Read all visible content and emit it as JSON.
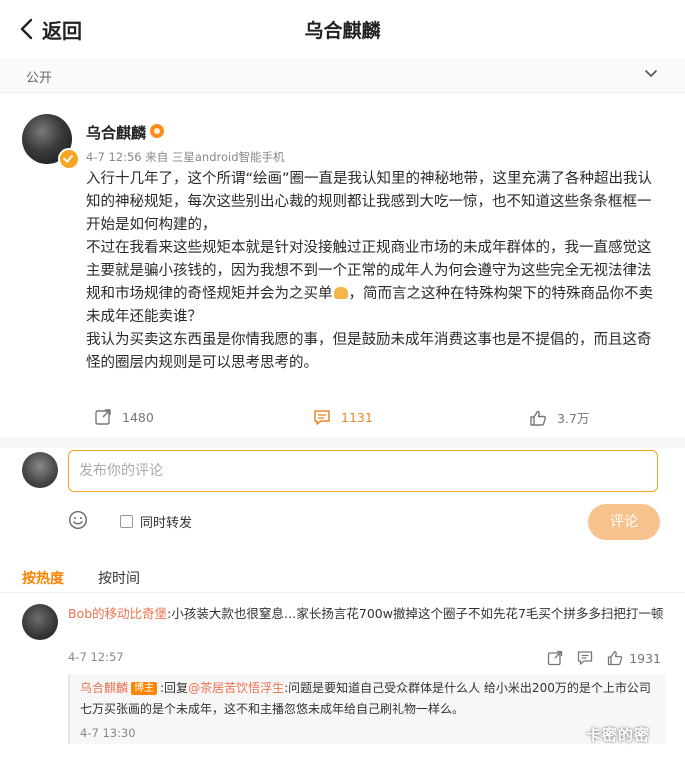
{
  "header": {
    "back_label": "返回",
    "title": "乌合麒麟"
  },
  "visibility": {
    "label": "公开"
  },
  "post": {
    "author": "乌合麒麟",
    "meta": "4-7 12:56 来自 三星android智能手机",
    "paragraphs": [
      "入行十几年了，这个所谓“绘画”圈一直是我认知里的神秘地带，这里充满了各种超出我认知的神秘规矩，每次这些别出心裁的规则都让我感到大吃一惊，也不知道这些条条框框一开始是如何构建的，",
      "不过在我看来这些规矩本就是针对没接触过正规商业市场的未成年群体的，我一直感觉这主要就是骗小孩钱的，因为我想不到一个正常的成年人为何会遵守为这些完全无视法律法规和市场规律的奇怪规矩并会为之买单",
      "，简而言之这种在特殊构架下的特殊商品你不卖未成年还能卖谁？",
      "我认为买卖这东西虽是你情我愿的事，但是鼓励未成年消费这事也是不提倡的，而且这奇怪的圈层内规则是可以思考思考的。"
    ],
    "reposts": "1480",
    "comments": "1131",
    "likes": "3.7万"
  },
  "composer": {
    "placeholder": "发布你的评论",
    "repost_label": "同时转发",
    "submit_label": "评论"
  },
  "sort": {
    "hot": "按热度",
    "time": "按时间"
  },
  "comments": [
    {
      "user": "Bob的移动比奇堡",
      "text": ":小孩装大款也很窒息…家长扬言花700w撤掉这个圈子不如先花7毛买个拼多多扫把打一顿",
      "time": "4-7 12:57",
      "likes": "1931",
      "reply": {
        "user": "乌合麒麟",
        "tag": "博主",
        "prefix": ":回复",
        "mention": "@茶居苦饮悟浮生",
        "text": ":问题是要知道自己受众群体是什么人 给小米出200万的是个上市公司 七万买张画的是个未成年，这不和主播忽悠未成年给自己刷礼物一样么。",
        "time": "4-7 13:30"
      }
    }
  ],
  "watermark": "卡密的密",
  "colors": {
    "accent": "#ff8200",
    "link": "#eb7350",
    "input_border": "#f5a623",
    "submit_bg": "#f7c28e"
  }
}
